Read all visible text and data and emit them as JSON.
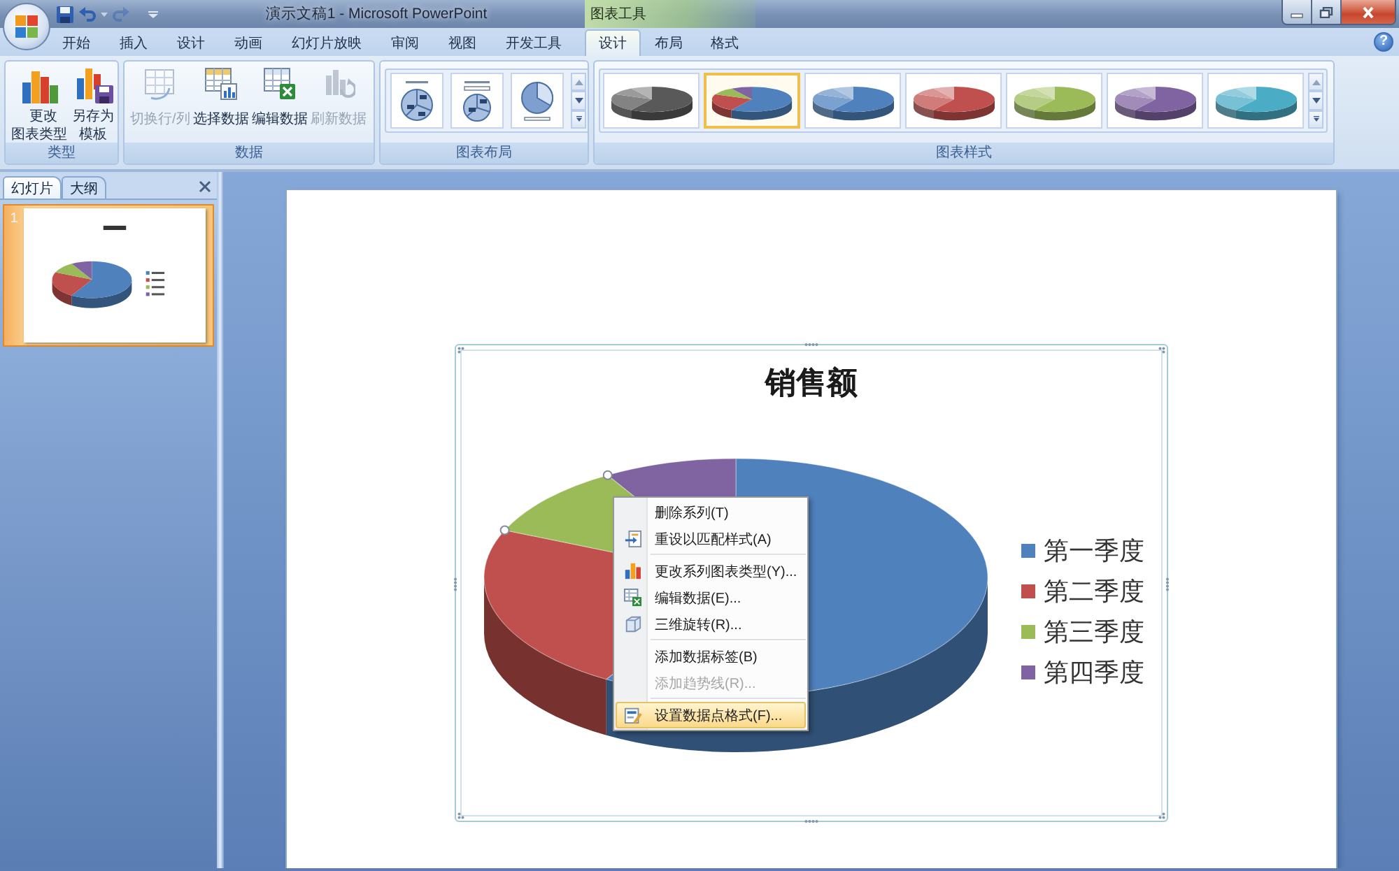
{
  "window": {
    "title": "演示文稿1 - Microsoft PowerPoint",
    "context_title": "图表工具"
  },
  "quick_access": [
    {
      "kind": "save",
      "disabled": false
    },
    {
      "kind": "undo",
      "disabled": false
    },
    {
      "kind": "redo",
      "disabled": true
    }
  ],
  "ribbon": {
    "tabs": [
      {
        "label": "开始",
        "selected": false
      },
      {
        "label": "插入",
        "selected": false
      },
      {
        "label": "设计",
        "selected": false
      },
      {
        "label": "动画",
        "selected": false
      },
      {
        "label": "幻灯片放映",
        "selected": false
      },
      {
        "label": "审阅",
        "selected": false
      },
      {
        "label": "视图",
        "selected": false
      },
      {
        "label": "开发工具",
        "selected": false
      }
    ],
    "context_tabs": [
      {
        "label": "设计",
        "selected": true
      },
      {
        "label": "布局",
        "selected": false
      },
      {
        "label": "格式",
        "selected": false
      }
    ],
    "help": "?",
    "groups": [
      {
        "label": "类型",
        "kind": "buttons",
        "buttons": [
          {
            "label": "更改图表类型",
            "disabled": false
          },
          {
            "label": "另存为模板",
            "disabled": false
          }
        ]
      },
      {
        "label": "数据",
        "kind": "buttons",
        "buttons": [
          {
            "label": "切换行/列",
            "disabled": true
          },
          {
            "label": "选择数据",
            "disabled": false
          },
          {
            "label": "编辑数据",
            "disabled": false
          },
          {
            "label": "刷新数据",
            "disabled": true
          }
        ]
      },
      {
        "label": "图表布局",
        "kind": "layouts",
        "items": [
          {
            "selected": false
          },
          {
            "selected": false
          },
          {
            "selected": false
          }
        ]
      },
      {
        "label": "图表样式",
        "kind": "styles",
        "items": [
          {
            "kind": "single",
            "color": "#595959",
            "selected": false
          },
          {
            "kind": "varied",
            "color": "#4f81bd",
            "selected": true
          },
          {
            "kind": "single",
            "color": "#4f81bd",
            "selected": false
          },
          {
            "kind": "single",
            "color": "#c0504d",
            "selected": false
          },
          {
            "kind": "single",
            "color": "#9bbb59",
            "selected": false
          },
          {
            "kind": "single",
            "color": "#8064a2",
            "selected": false
          },
          {
            "kind": "single",
            "color": "#4bacc6",
            "selected": false
          }
        ]
      }
    ]
  },
  "left_pane": {
    "tabs": [
      {
        "label": "幻灯片",
        "selected": true
      },
      {
        "label": "大纲",
        "selected": false
      }
    ],
    "slides": [
      {
        "number": "1",
        "selected": true
      }
    ]
  },
  "chart": {
    "title": "销售额",
    "slices": [
      {
        "selected": false
      },
      {
        "selected": false
      },
      {
        "selected": true
      },
      {
        "selected": false
      }
    ],
    "legend": [
      {
        "label": "第一季度",
        "color": "#4f81bd"
      },
      {
        "label": "第二季度",
        "color": "#c0504d"
      },
      {
        "label": "第三季度",
        "color": "#9bbb59"
      },
      {
        "label": "第四季度",
        "color": "#8064a2"
      }
    ]
  },
  "context_menu": {
    "groups": [
      {
        "items": [
          {
            "label": "删除系列(T)",
            "disabled": false,
            "highlighted": false
          },
          {
            "label": "重设以匹配样式(A)",
            "disabled": false,
            "highlighted": false
          }
        ]
      },
      {
        "items": [
          {
            "label": "更改系列图表类型(Y)...",
            "disabled": false,
            "highlighted": false
          },
          {
            "label": "编辑数据(E)...",
            "disabled": false,
            "highlighted": false
          },
          {
            "label": "三维旋转(R)...",
            "disabled": false,
            "highlighted": false
          }
        ]
      },
      {
        "items": [
          {
            "label": "添加数据标签(B)",
            "disabled": false,
            "highlighted": false
          },
          {
            "label": "添加趋势线(R)...",
            "disabled": true,
            "highlighted": false
          }
        ]
      },
      {
        "items": [
          {
            "label": "设置数据点格式(F)...",
            "disabled": false,
            "highlighted": true
          }
        ]
      }
    ]
  }
}
